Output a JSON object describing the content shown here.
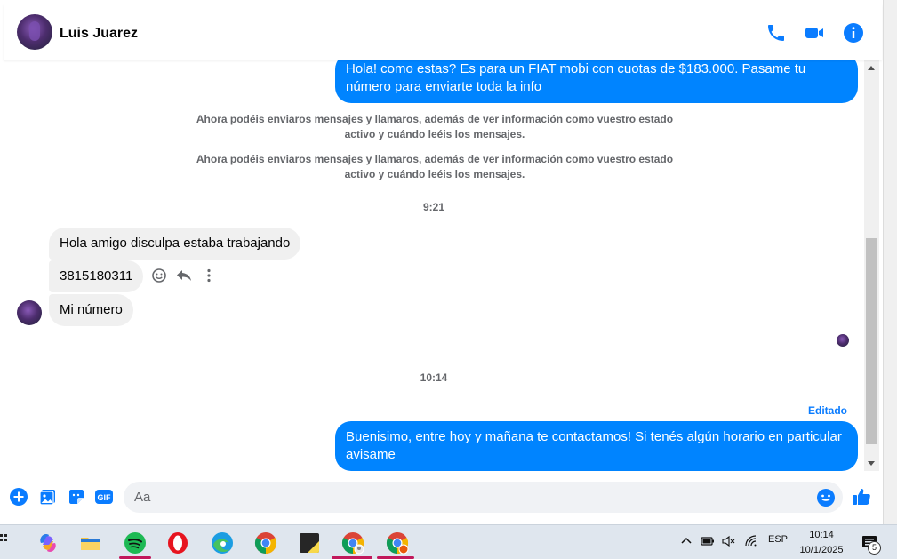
{
  "header": {
    "contact_name": "Luis Juarez",
    "icons": [
      "phone-icon",
      "video-camera-icon",
      "info-icon"
    ],
    "accent_color": "#0a7cff"
  },
  "messages": {
    "outgoing_top": "Hola! como estas? Es para un FIAT mobi con cuotas de $183.000. Pasame tu número para enviarte toda la info",
    "notice_1": "Ahora podéis enviaros mensajes y llamaros, además de ver información como vuestro estado activo y cuándo leéis los mensajes.",
    "notice_2": "Ahora podéis enviaros mensajes y llamaros, además de ver información como vuestro estado activo y cuándo leéis los mensajes.",
    "time_1": "9:21",
    "incoming_1": "Hola amigo disculpa estaba trabajando",
    "incoming_2": "3815180311",
    "incoming_3": "Mi número",
    "time_2": "10:14",
    "edited_label": "Editado",
    "outgoing_bottom": "Buenisimo, entre hoy y mañana te contactamos! Si tenés algún horario en particular avisame",
    "outgoing_color": "#0084ff",
    "incoming_color": "#f0f0f0"
  },
  "composer": {
    "placeholder": "Aa",
    "icons": [
      "plus-icon",
      "photo-icon",
      "sticker-icon",
      "gif-icon",
      "emoji-icon",
      "thumbs-up-icon"
    ],
    "gif_label": "GIF"
  },
  "taskbar": {
    "apps": [
      "copilot-icon",
      "file-explorer-icon",
      "spotify-icon",
      "opera-icon",
      "edge-icon",
      "chrome-icon",
      "sticky-notes-icon",
      "chrome-profile-icon",
      "chrome-profile-2-icon"
    ],
    "language": "ESP",
    "time": "10:14",
    "date": "10/1/2025",
    "notification_count": "5"
  }
}
